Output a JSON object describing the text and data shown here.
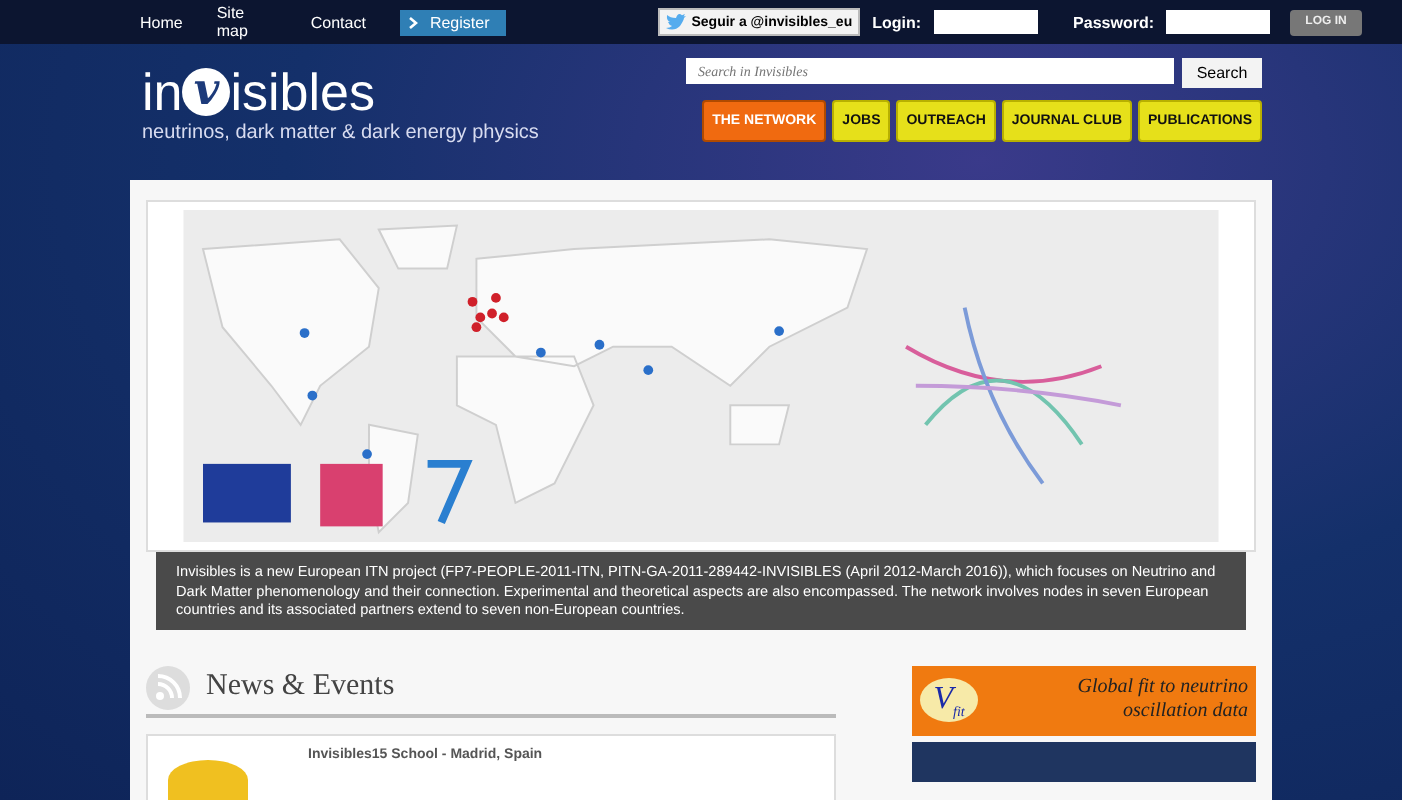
{
  "top_nav": {
    "links": [
      "Home",
      "Site map",
      "Contact"
    ],
    "register": "Register",
    "twitter": "Seguir a @invisibles_eu",
    "login_label": "Login:",
    "password_label": "Password:",
    "login_button": "LOG IN"
  },
  "logo": {
    "before": "in",
    "mark": "v",
    "after": "isibles",
    "tagline": "neutrinos, dark matter & dark energy physics"
  },
  "search": {
    "placeholder": "Search in Invisibles",
    "button": "Search"
  },
  "menu": [
    {
      "label": "THE NETWORK",
      "selected": true
    },
    {
      "label": "JOBS",
      "selected": false
    },
    {
      "label": "OUTREACH",
      "selected": false
    },
    {
      "label": "JOURNAL CLUB",
      "selected": false
    },
    {
      "label": "PUBLICATIONS",
      "selected": false
    }
  ],
  "intro": "Invisibles is a new European ITN project (FP7-PEOPLE-2011-ITN, PITN-GA-2011-289442-INVISIBLES (April 2012-March 2016)), which focuses on Neutrino and Dark Matter phenomenology and their connection. Experimental and theoretical aspects are also encompassed. The network involves nodes in seven European countries and its associated partners extend to seven non-European countries.",
  "news": {
    "title": "News & Events",
    "items": [
      {
        "title": "Invisibles15 School - Madrid, Spain"
      }
    ]
  },
  "sidebar_ad": {
    "logo": "V",
    "logo_sub": "fit",
    "text": "Global fit to neutrino oscillation data"
  }
}
